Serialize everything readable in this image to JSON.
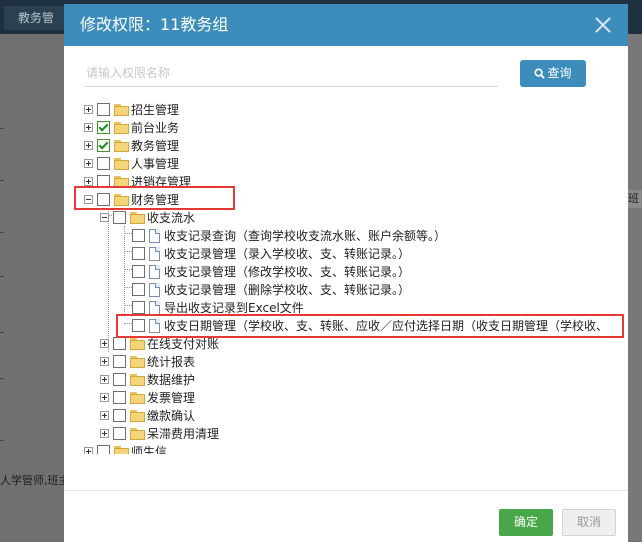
{
  "background": {
    "tab_label": "教务管",
    "right_text": "班11",
    "left_text": "人学管师,班主"
  },
  "dialog": {
    "title": "修改权限：11教务组",
    "search": {
      "placeholder": "请输入权限名称",
      "value": ""
    },
    "search_button": "查询",
    "ok_button": "确定",
    "cancel_button": "取消",
    "accent_color": "#3c8dbc",
    "highlight_color": "#e53935"
  },
  "tree": [
    {
      "label": "招生管理",
      "type": "folder",
      "checked": false,
      "expander": "plus"
    },
    {
      "label": "前台业务",
      "type": "folder",
      "checked": true,
      "expander": "plus"
    },
    {
      "label": "教务管理",
      "type": "folder",
      "checked": true,
      "expander": "plus"
    },
    {
      "label": "人事管理",
      "type": "folder",
      "checked": false,
      "expander": "plus"
    },
    {
      "label": "进销存管理",
      "type": "folder",
      "checked": false,
      "expander": "plus"
    },
    {
      "label": "财务管理",
      "type": "folder",
      "checked": false,
      "expander": "minus",
      "highlighted": true
    },
    {
      "label": "收支流水",
      "type": "folder",
      "checked": false,
      "expander": "minus"
    },
    {
      "label": "收支记录查询（查询学校收支流水账、账户余额等。）",
      "type": "file",
      "checked": false
    },
    {
      "label": "收支记录管理（录入学校收、支、转账记录。）",
      "type": "file",
      "checked": false
    },
    {
      "label": "收支记录管理（修改学校收、支、转账记录。）",
      "type": "file",
      "checked": false
    },
    {
      "label": "收支记录管理（删除学校收、支、转账记录。）",
      "type": "file",
      "checked": false
    },
    {
      "label": "导出收支记录到Excel文件",
      "type": "file",
      "checked": false
    },
    {
      "label": "收支日期管理（学校收、支、转账、应收／应付选择日期（收支日期管理（学校收、",
      "type": "file",
      "checked": false,
      "highlighted": true
    },
    {
      "label": "在线支付对账",
      "type": "folder",
      "checked": false,
      "expander": "plus"
    },
    {
      "label": "统计报表",
      "type": "folder",
      "checked": false,
      "expander": "plus"
    },
    {
      "label": "数据维护",
      "type": "folder",
      "checked": false,
      "expander": "plus"
    },
    {
      "label": "发票管理",
      "type": "folder",
      "checked": false,
      "expander": "plus"
    },
    {
      "label": "缴款确认",
      "type": "folder",
      "checked": false,
      "expander": "plus"
    },
    {
      "label": "呆滞费用清理",
      "type": "folder",
      "checked": false,
      "expander": "plus"
    },
    {
      "label": "师生信",
      "type": "folder",
      "checked": false,
      "expander": "plus"
    }
  ]
}
